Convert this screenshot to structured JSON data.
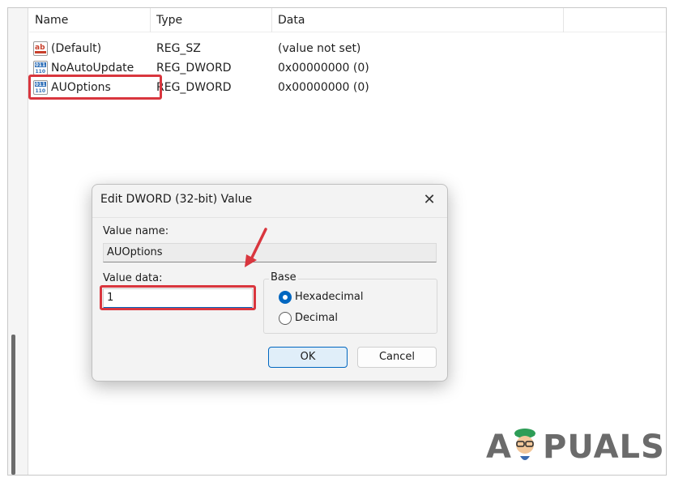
{
  "columns": {
    "name": "Name",
    "type": "Type",
    "data": "Data"
  },
  "rows": [
    {
      "icon": "string-value-icon",
      "name": "(Default)",
      "type": "REG_SZ",
      "data": "(value not set)"
    },
    {
      "icon": "dword-value-icon",
      "name": "NoAutoUpdate",
      "type": "REG_DWORD",
      "data": "0x00000000 (0)"
    },
    {
      "icon": "dword-value-icon",
      "name": "AUOptions",
      "type": "REG_DWORD",
      "data": "0x00000000 (0)"
    }
  ],
  "dialog": {
    "title": "Edit DWORD (32-bit) Value",
    "close_glyph": "✕",
    "value_name_label": "Value name:",
    "value_name": "AUOptions",
    "value_data_label": "Value data:",
    "value_data": "1",
    "base_label": "Base",
    "base_options": [
      {
        "label": "Hexadecimal",
        "checked": true
      },
      {
        "label": "Decimal",
        "checked": false
      }
    ],
    "ok_label": "OK",
    "cancel_label": "Cancel"
  },
  "watermark": {
    "left": "A",
    "right": "PUALS"
  },
  "colors": {
    "highlight": "#d9363e",
    "accent": "#0067c0"
  }
}
